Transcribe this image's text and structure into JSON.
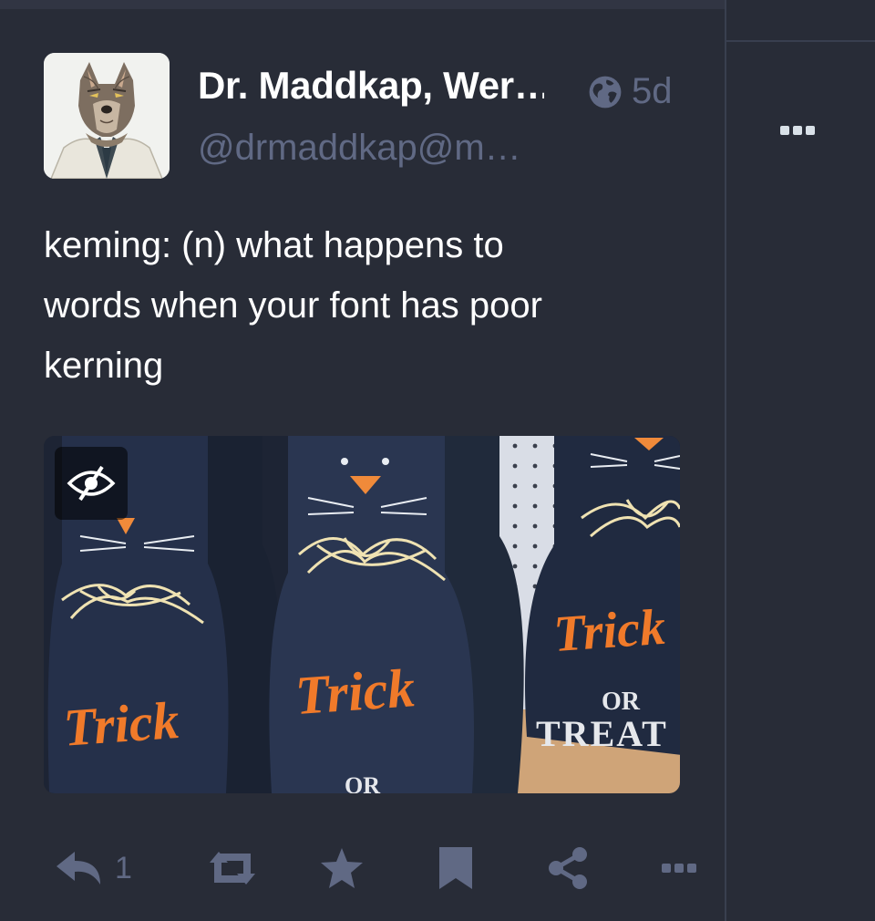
{
  "post": {
    "display_name": "Dr. Maddkap, Wer…",
    "handle": "@drmaddkap@m…",
    "visibility": "globe-icon",
    "timestamp": "5d",
    "content_lines": [
      "keming: (n) what happens to",
      "words when your font has poor",
      "kerning"
    ],
    "media": {
      "hide_icon": "eye-slash-icon",
      "sign_texts": [
        "Trick",
        "Trick",
        "Trick",
        "OR",
        "TREAT",
        "OR"
      ]
    },
    "actions": {
      "reply_count": "1",
      "icons": [
        "reply-icon",
        "boost-icon",
        "star-icon",
        "bookmark-icon",
        "share-icon",
        "more-icon"
      ]
    }
  },
  "colors": {
    "background": "#282c37",
    "name": "#ffffff",
    "muted": "#606984",
    "sign_text": "#f07a2a"
  }
}
